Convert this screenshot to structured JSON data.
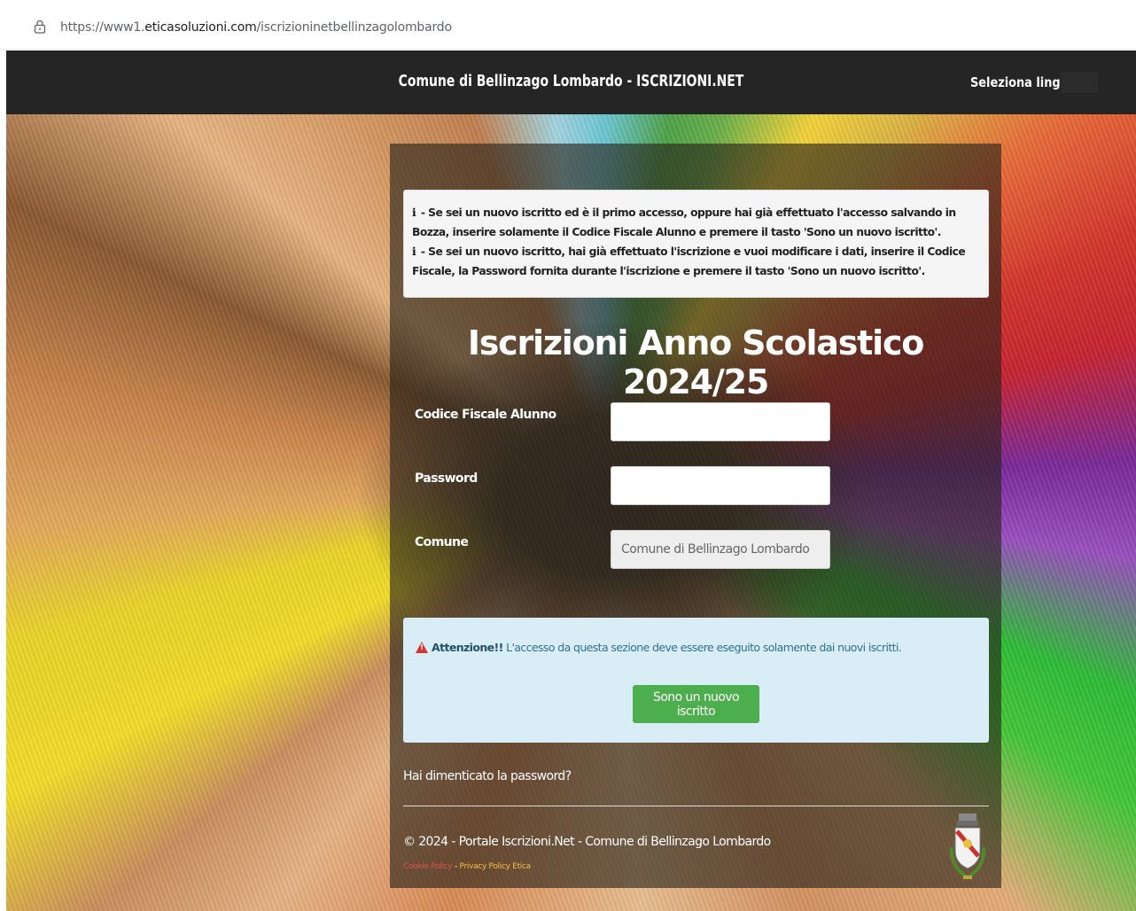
{
  "browser": {
    "url_prefix": "https://www1.",
    "url_domain": "eticasoluzioni.com",
    "url_path": "/iscrizioninetbellinzagolombardo",
    "lock_icon": "lock-icon"
  },
  "header": {
    "title": "Comune di Bellinzago Lombardo - ISCRIZIONI.NET",
    "language_label": "Seleziona lingua"
  },
  "info": {
    "icon": "i",
    "line1": " - Se sei un nuovo iscritto ed è il primo accesso, oppure hai già effettuato l'accesso salvando in Bozza, inserire solamente il Codice Fiscale Alunno e premere il tasto 'Sono un nuovo iscritto'.",
    "line2": " - Se sei un nuovo iscritto, hai già effettuato l'iscrizione e vuoi modificare i dati, inserire il Codice Fiscale, la Password fornita durante l'iscrizione e premere il tasto 'Sono un nuovo iscritto'."
  },
  "form": {
    "heading": "Iscrizioni Anno Scolastico 2024/25",
    "codice_label": "Codice Fiscale Alunno",
    "codice_value": "",
    "password_label": "Password",
    "password_value": "",
    "comune_label": "Comune",
    "comune_value": "Comune di Bellinzago Lombardo"
  },
  "alert": {
    "strong": "Attenzione!!",
    "text": " L'accesso da questa sezione deve essere eseguito solamente dai nuovi iscritti.",
    "button": "Sono un nuovo iscritto"
  },
  "forgot_password": "Hai dimenticato la password?",
  "footer": {
    "copyright": "© 2024 - Portale Iscrizioni.Net - Comune di Bellinzago Lombardo",
    "cookie_policy": "Cookie Policy",
    "separator": " - ",
    "privacy_policy": "Privacy Policy Etica"
  },
  "colors": {
    "nav_bg": "#252525",
    "alert_bg": "#d9edf7",
    "button_green": "#4cae4c",
    "warning_red": "#d9332e"
  }
}
